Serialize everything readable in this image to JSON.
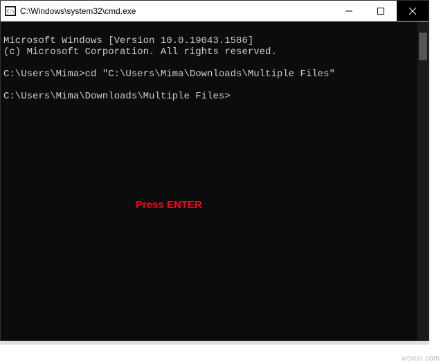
{
  "window": {
    "title": "C:\\Windows\\system32\\cmd.exe"
  },
  "console": {
    "line1": "Microsoft Windows [Version 10.0.19043.1586]",
    "line2": "(c) Microsoft Corporation. All rights reserved.",
    "blank1": "",
    "line3": "C:\\Users\\Mima>cd \"C:\\Users\\Mima\\Downloads\\Multiple Files\"",
    "blank2": "",
    "line4": "C:\\Users\\Mima\\Downloads\\Multiple Files>"
  },
  "annotation": {
    "text": "Press ENTER"
  },
  "watermark": "wsxun.com"
}
